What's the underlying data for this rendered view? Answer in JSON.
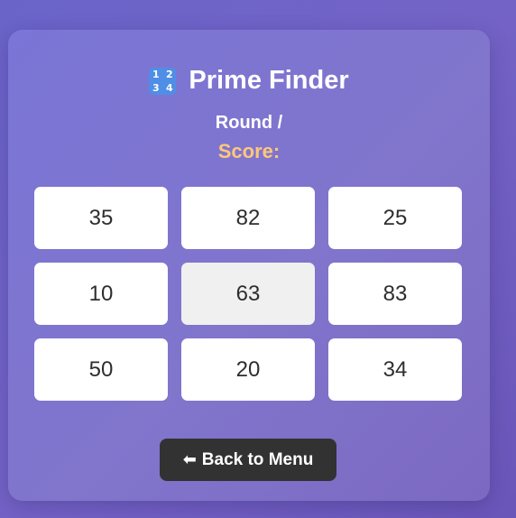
{
  "game": {
    "title": "Prime Finder",
    "title_icon": "input-numbers-icon",
    "title_icon_digits": [
      "1",
      "2",
      "3",
      "4"
    ],
    "round_label": "Round /",
    "score_label": "Score:"
  },
  "grid": {
    "cells": [
      {
        "value": "35"
      },
      {
        "value": "82"
      },
      {
        "value": "25"
      },
      {
        "value": "10"
      },
      {
        "value": "63",
        "highlighted": true
      },
      {
        "value": "83"
      },
      {
        "value": "50"
      },
      {
        "value": "20"
      },
      {
        "value": "34"
      }
    ]
  },
  "footer": {
    "back_arrow_icon": "left-arrow-icon",
    "back_arrow_glyph": "⬅",
    "back_label": "Back to Menu"
  },
  "colors": {
    "background": "#6f5fc4",
    "score_accent": "#ffc77a",
    "cell_highlight": "#f0f0f0",
    "button_dark": "#323232"
  }
}
